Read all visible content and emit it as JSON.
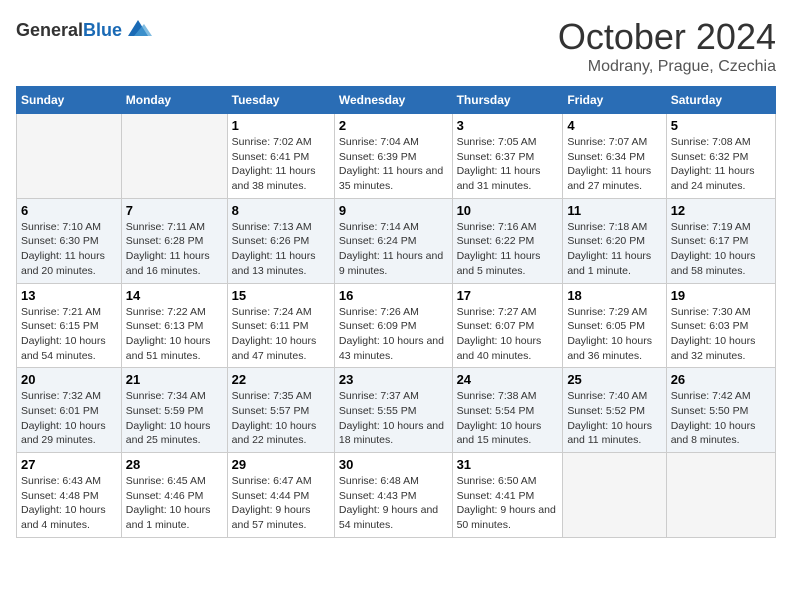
{
  "header": {
    "logo_general": "General",
    "logo_blue": "Blue",
    "month": "October 2024",
    "location": "Modrany, Prague, Czechia"
  },
  "weekdays": [
    "Sunday",
    "Monday",
    "Tuesday",
    "Wednesday",
    "Thursday",
    "Friday",
    "Saturday"
  ],
  "weeks": [
    [
      {
        "day": "",
        "info": ""
      },
      {
        "day": "",
        "info": ""
      },
      {
        "day": "1",
        "info": "Sunrise: 7:02 AM\nSunset: 6:41 PM\nDaylight: 11 hours and 38 minutes."
      },
      {
        "day": "2",
        "info": "Sunrise: 7:04 AM\nSunset: 6:39 PM\nDaylight: 11 hours and 35 minutes."
      },
      {
        "day": "3",
        "info": "Sunrise: 7:05 AM\nSunset: 6:37 PM\nDaylight: 11 hours and 31 minutes."
      },
      {
        "day": "4",
        "info": "Sunrise: 7:07 AM\nSunset: 6:34 PM\nDaylight: 11 hours and 27 minutes."
      },
      {
        "day": "5",
        "info": "Sunrise: 7:08 AM\nSunset: 6:32 PM\nDaylight: 11 hours and 24 minutes."
      }
    ],
    [
      {
        "day": "6",
        "info": "Sunrise: 7:10 AM\nSunset: 6:30 PM\nDaylight: 11 hours and 20 minutes."
      },
      {
        "day": "7",
        "info": "Sunrise: 7:11 AM\nSunset: 6:28 PM\nDaylight: 11 hours and 16 minutes."
      },
      {
        "day": "8",
        "info": "Sunrise: 7:13 AM\nSunset: 6:26 PM\nDaylight: 11 hours and 13 minutes."
      },
      {
        "day": "9",
        "info": "Sunrise: 7:14 AM\nSunset: 6:24 PM\nDaylight: 11 hours and 9 minutes."
      },
      {
        "day": "10",
        "info": "Sunrise: 7:16 AM\nSunset: 6:22 PM\nDaylight: 11 hours and 5 minutes."
      },
      {
        "day": "11",
        "info": "Sunrise: 7:18 AM\nSunset: 6:20 PM\nDaylight: 11 hours and 1 minute."
      },
      {
        "day": "12",
        "info": "Sunrise: 7:19 AM\nSunset: 6:17 PM\nDaylight: 10 hours and 58 minutes."
      }
    ],
    [
      {
        "day": "13",
        "info": "Sunrise: 7:21 AM\nSunset: 6:15 PM\nDaylight: 10 hours and 54 minutes."
      },
      {
        "day": "14",
        "info": "Sunrise: 7:22 AM\nSunset: 6:13 PM\nDaylight: 10 hours and 51 minutes."
      },
      {
        "day": "15",
        "info": "Sunrise: 7:24 AM\nSunset: 6:11 PM\nDaylight: 10 hours and 47 minutes."
      },
      {
        "day": "16",
        "info": "Sunrise: 7:26 AM\nSunset: 6:09 PM\nDaylight: 10 hours and 43 minutes."
      },
      {
        "day": "17",
        "info": "Sunrise: 7:27 AM\nSunset: 6:07 PM\nDaylight: 10 hours and 40 minutes."
      },
      {
        "day": "18",
        "info": "Sunrise: 7:29 AM\nSunset: 6:05 PM\nDaylight: 10 hours and 36 minutes."
      },
      {
        "day": "19",
        "info": "Sunrise: 7:30 AM\nSunset: 6:03 PM\nDaylight: 10 hours and 32 minutes."
      }
    ],
    [
      {
        "day": "20",
        "info": "Sunrise: 7:32 AM\nSunset: 6:01 PM\nDaylight: 10 hours and 29 minutes."
      },
      {
        "day": "21",
        "info": "Sunrise: 7:34 AM\nSunset: 5:59 PM\nDaylight: 10 hours and 25 minutes."
      },
      {
        "day": "22",
        "info": "Sunrise: 7:35 AM\nSunset: 5:57 PM\nDaylight: 10 hours and 22 minutes."
      },
      {
        "day": "23",
        "info": "Sunrise: 7:37 AM\nSunset: 5:55 PM\nDaylight: 10 hours and 18 minutes."
      },
      {
        "day": "24",
        "info": "Sunrise: 7:38 AM\nSunset: 5:54 PM\nDaylight: 10 hours and 15 minutes."
      },
      {
        "day": "25",
        "info": "Sunrise: 7:40 AM\nSunset: 5:52 PM\nDaylight: 10 hours and 11 minutes."
      },
      {
        "day": "26",
        "info": "Sunrise: 7:42 AM\nSunset: 5:50 PM\nDaylight: 10 hours and 8 minutes."
      }
    ],
    [
      {
        "day": "27",
        "info": "Sunrise: 6:43 AM\nSunset: 4:48 PM\nDaylight: 10 hours and 4 minutes."
      },
      {
        "day": "28",
        "info": "Sunrise: 6:45 AM\nSunset: 4:46 PM\nDaylight: 10 hours and 1 minute."
      },
      {
        "day": "29",
        "info": "Sunrise: 6:47 AM\nSunset: 4:44 PM\nDaylight: 9 hours and 57 minutes."
      },
      {
        "day": "30",
        "info": "Sunrise: 6:48 AM\nSunset: 4:43 PM\nDaylight: 9 hours and 54 minutes."
      },
      {
        "day": "31",
        "info": "Sunrise: 6:50 AM\nSunset: 4:41 PM\nDaylight: 9 hours and 50 minutes."
      },
      {
        "day": "",
        "info": ""
      },
      {
        "day": "",
        "info": ""
      }
    ]
  ]
}
